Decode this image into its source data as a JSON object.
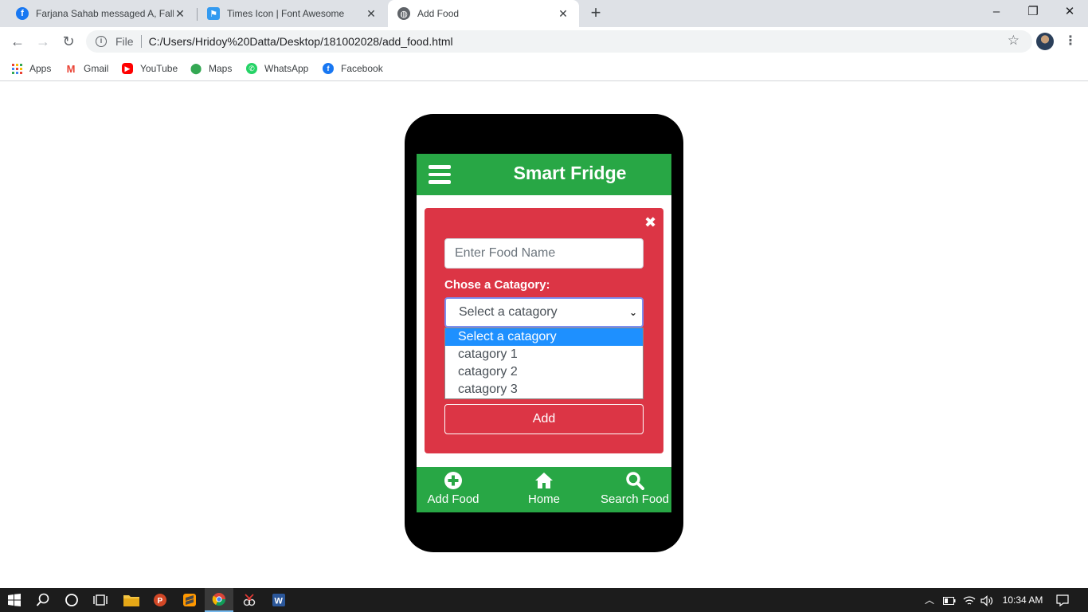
{
  "browser": {
    "tabs": [
      {
        "title": "Farjana Sahab messaged A, Fall S",
        "icon": "facebook-icon",
        "color": "#1877f2"
      },
      {
        "title": "Times Icon | Font Awesome",
        "icon": "font-awesome-flag-icon",
        "color": "#339af0"
      },
      {
        "title": "Add Food",
        "icon": "globe-icon",
        "color": "#5f6368"
      }
    ],
    "address": {
      "scheme": "File",
      "url": "C:/Users/Hridoy%20Datta/Desktop/181002028/add_food.html"
    },
    "bookmarks": [
      {
        "label": "Apps",
        "icon": "apps-grid-icon"
      },
      {
        "label": "Gmail",
        "icon": "gmail-icon"
      },
      {
        "label": "YouTube",
        "icon": "youtube-icon"
      },
      {
        "label": "Maps",
        "icon": "maps-pin-icon"
      },
      {
        "label": "WhatsApp",
        "icon": "whatsapp-icon"
      },
      {
        "label": "Facebook",
        "icon": "facebook-icon"
      }
    ]
  },
  "app": {
    "title": "Smart Fridge",
    "form": {
      "food_placeholder": "Enter Food Name",
      "category_label": "Chose a Catagory:",
      "category_selected": "Select a catagory",
      "category_options": [
        "Select a catagory",
        "catagory 1",
        "catagory 2",
        "catagory 3"
      ],
      "submit_label": "Add"
    },
    "footer_nav": [
      {
        "label": "Add Food",
        "icon": "plus-circle-icon"
      },
      {
        "label": "Home",
        "icon": "home-icon"
      },
      {
        "label": "Search Food",
        "icon": "search-icon"
      }
    ],
    "colors": {
      "header": "#28a745",
      "card": "#dc3545",
      "selected_option": "#1e90ff"
    }
  },
  "taskbar": {
    "time": "10:34 AM"
  }
}
